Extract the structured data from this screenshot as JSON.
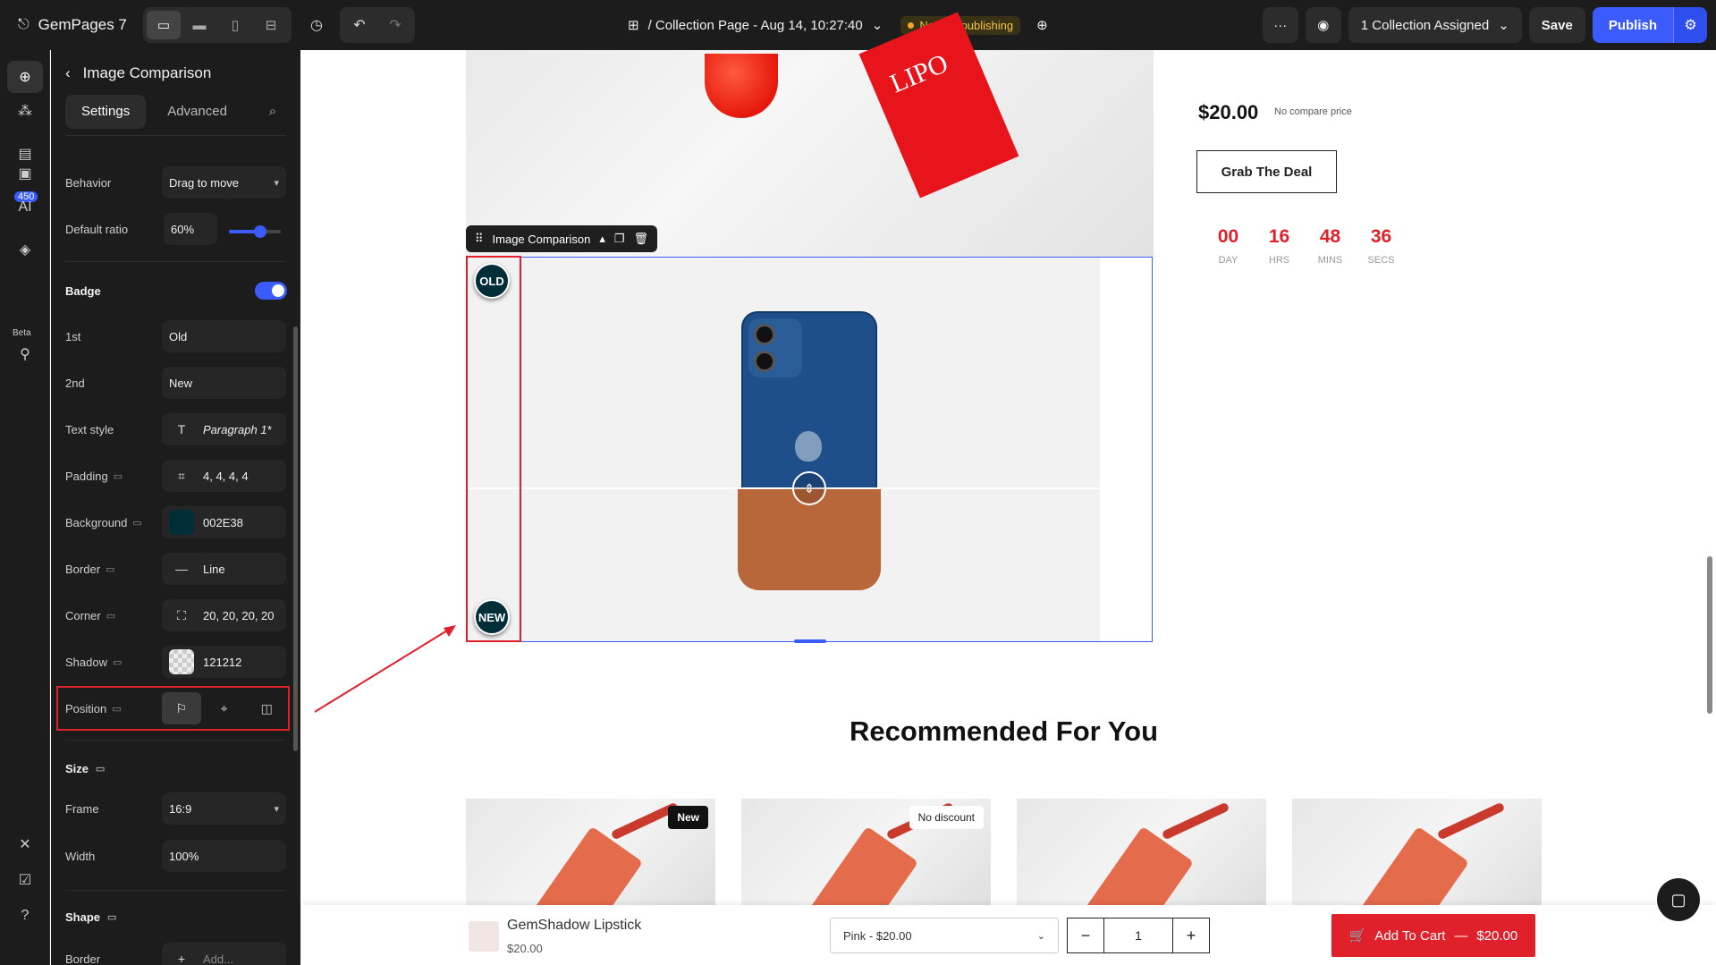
{
  "app": {
    "name": "GemPages 7",
    "page_title": "/ Collection Page - Aug 14, 10:27:40",
    "status": "Need republishing",
    "collection_assigned": "1 Collection Assigned",
    "save_label": "Save",
    "publish_label": "Publish"
  },
  "rail": {
    "count": "450",
    "beta": "Beta",
    "ai": "AI"
  },
  "panel": {
    "title": "Image Comparison",
    "tabs": [
      "Settings",
      "Advanced"
    ],
    "behavior": {
      "label": "Behavior",
      "value": "Drag to move"
    },
    "default_ratio": {
      "label": "Default ratio",
      "value": "60%",
      "level": 0.6
    },
    "badge": {
      "title": "Badge",
      "enabled": true,
      "first": {
        "label": "1st",
        "value": "Old"
      },
      "second": {
        "label": "2nd",
        "value": "New"
      },
      "text_style": {
        "label": "Text style",
        "value": "Paragraph 1*"
      },
      "padding": {
        "label": "Padding",
        "value": "4, 4, 4, 4"
      },
      "background": {
        "label": "Background",
        "value": "002E38",
        "color": "#002E38"
      },
      "border": {
        "label": "Border",
        "value": "Line"
      },
      "corner": {
        "label": "Corner",
        "value": "20, 20, 20, 20"
      },
      "shadow": {
        "label": "Shadow",
        "value": "121212"
      },
      "position": {
        "label": "Position",
        "options": [
          "left",
          "center",
          "right"
        ],
        "selected": "left"
      }
    },
    "size": {
      "title": "Size",
      "frame": {
        "label": "Frame",
        "value": "16:9"
      },
      "width": {
        "label": "Width",
        "value": "100%"
      }
    },
    "shape": {
      "title": "Shape",
      "border": {
        "label": "Border",
        "value": "Add..."
      }
    }
  },
  "canvas": {
    "price": "$20.00",
    "compare_price": "No compare price",
    "deal_button": "Grab The Deal",
    "countdown": [
      {
        "num": "00",
        "unit": "DAY"
      },
      {
        "num": "16",
        "unit": "HRS"
      },
      {
        "num": "48",
        "unit": "MINS"
      },
      {
        "num": "36",
        "unit": "SECS"
      }
    ],
    "top_box_text": "LIPO",
    "element_toolbar": "Image Comparison",
    "badge_old": "OLD",
    "badge_new": "NEW",
    "recommended_title": "Recommended For You",
    "cards": [
      {
        "tag": "New",
        "tag_style": "dark"
      },
      {
        "tag": "No discount",
        "tag_style": "light"
      },
      {
        "tag": "",
        "tag_style": ""
      },
      {
        "tag": "",
        "tag_style": ""
      }
    ]
  },
  "sticky": {
    "product_name": "GemShadow Lipstick",
    "product_price": "$20.00",
    "variant": "Pink - $20.00",
    "quantity": "1",
    "cart_label": "Add To Cart",
    "cart_price": "$20.00"
  },
  "colors": {
    "accent": "#3b5bfd",
    "danger": "#e0212b",
    "badge_bg": "#002E38"
  }
}
